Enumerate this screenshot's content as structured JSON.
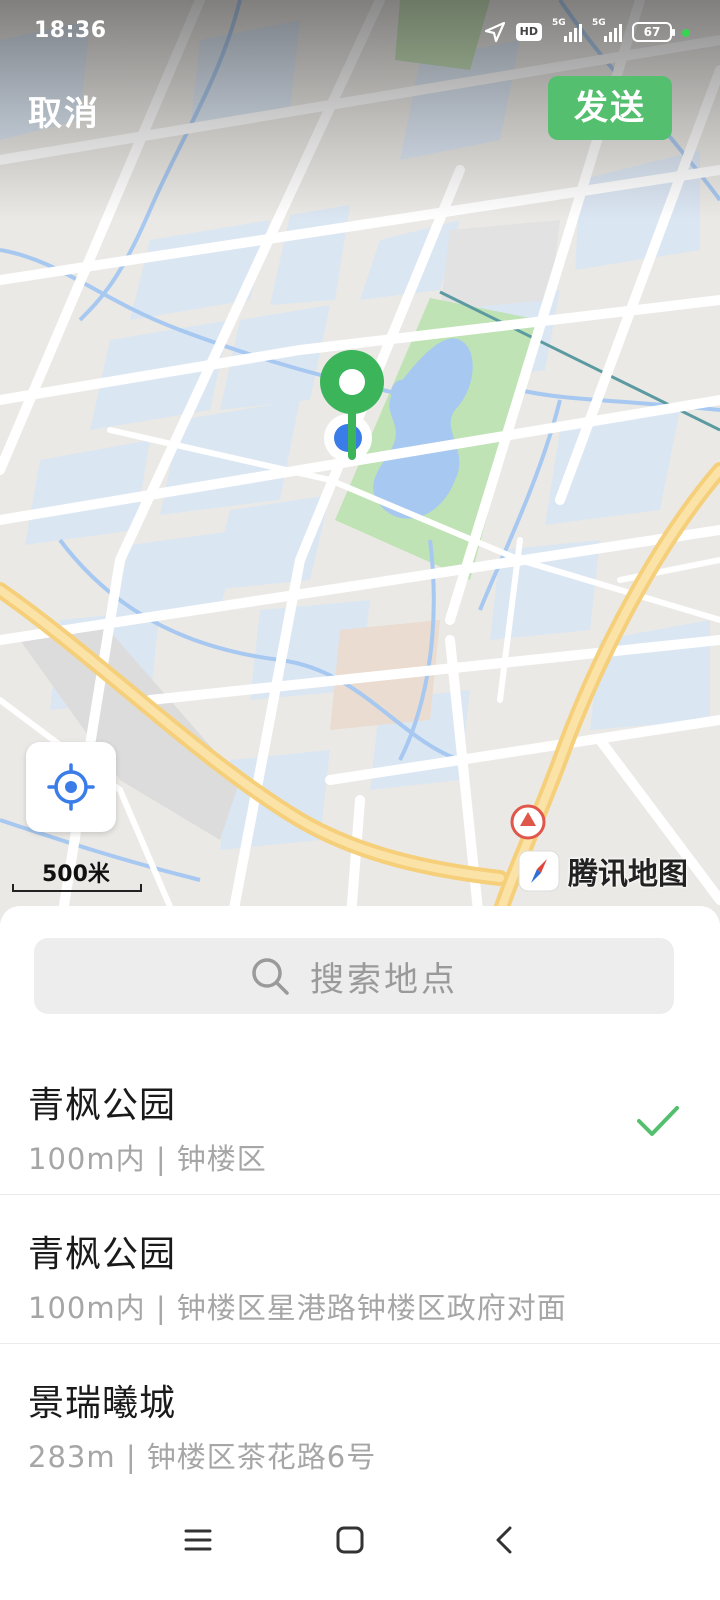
{
  "status_bar": {
    "time": "18:36",
    "hd_label": "HD",
    "net1": "5G",
    "net2": "5G",
    "battery": "67"
  },
  "top_bar": {
    "cancel_label": "取消",
    "send_label": "发送"
  },
  "map": {
    "scale_label": "500米",
    "brand_label": "腾讯地图",
    "icons": [
      "location-pin-icon",
      "current-location-dot-icon",
      "locate-me-icon",
      "compass-icon",
      "poi-marker-icon"
    ]
  },
  "search": {
    "placeholder": "搜索地点",
    "icon": "search-icon"
  },
  "poi_list": [
    {
      "name": "青枫公园",
      "detail": "100m内 | 钟楼区",
      "selected": true
    },
    {
      "name": "青枫公园",
      "detail": "100m内 | 钟楼区星港路钟楼区政府对面",
      "selected": false
    },
    {
      "name": "景瑞曦城",
      "detail": "283m | 钟楼区茶花路6号",
      "selected": false
    }
  ],
  "colors": {
    "accent": "#54c06f",
    "check": "#54c06f",
    "pin": "#3cb55a",
    "location_dot": "#3a7de8",
    "park": "#bfe3b4",
    "water": "#a7c8f0",
    "block": "#dbe6f3",
    "major_road": "#f7d78b"
  },
  "nav_bar": {
    "icons": [
      "menu-icon",
      "home-icon",
      "back-icon"
    ]
  }
}
